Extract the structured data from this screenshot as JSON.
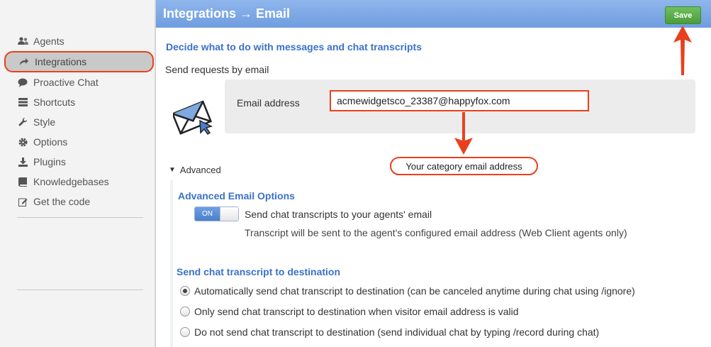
{
  "sidebar": {
    "items": [
      {
        "label": "Agents",
        "icon": "agents-icon"
      },
      {
        "label": "Integrations",
        "icon": "share-arrow-icon"
      },
      {
        "label": "Proactive Chat",
        "icon": "chat-bubble-icon"
      },
      {
        "label": "Shortcuts",
        "icon": "list-icon"
      },
      {
        "label": "Style",
        "icon": "wrench-icon"
      },
      {
        "label": "Options",
        "icon": "gear-icon"
      },
      {
        "label": "Plugins",
        "icon": "download-icon"
      },
      {
        "label": "Knowledgebases",
        "icon": "book-icon"
      },
      {
        "label": "Get the code",
        "icon": "edit-icon"
      }
    ]
  },
  "header": {
    "title": "Integrations → Email",
    "save_label": "Save"
  },
  "main": {
    "section_title": "Decide what to do with messages and chat transcripts",
    "send_requests": "Send requests by email",
    "email_label": "Email address",
    "email_value": "acmewidgetsco_23387@happyfox.com",
    "callout": "Your category email address",
    "advanced_label": "Advanced",
    "advanced_title": "Advanced Email Options",
    "switch_on": "ON",
    "transcript_to_agents": "Send chat transcripts to your agents' email",
    "transcript_note": "Transcript will be sent to the agent's configured email address (Web Client agents only)",
    "destination_title": "Send chat transcript to destination",
    "destination_options": [
      "Automatically send chat transcript to destination (can be canceled anytime during chat using /ignore)",
      "Only send chat transcript to destination when visitor email address is valid",
      "Do not send chat transcript to destination (send individual chat by typing /record during chat)"
    ],
    "selected_option": 0
  },
  "colors": {
    "accent": "#3a72c9",
    "annotation": "#e8401c",
    "save": "#4b9d3a",
    "header": "#7aa7e5"
  }
}
